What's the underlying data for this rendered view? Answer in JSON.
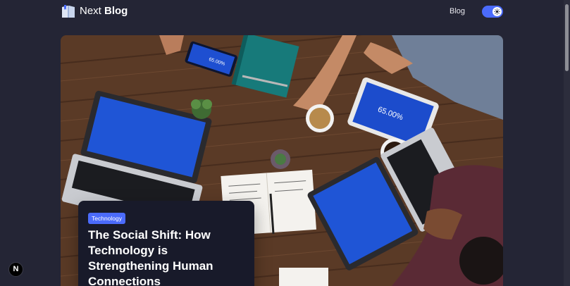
{
  "header": {
    "logo_light": "Next",
    "logo_bold": "Blog",
    "nav_blog": "Blog",
    "theme_toggle_state": "dark"
  },
  "hero": {
    "image_icon": "photo-teamwork-laptops"
  },
  "post": {
    "category": "Technology",
    "title": "The Social Shift: How Technology is Strengthening Human Connections"
  },
  "devtools": {
    "badge_letter": "N"
  },
  "colors": {
    "background": "#242535",
    "card": "#181a2a",
    "accent": "#4b6bfb"
  }
}
